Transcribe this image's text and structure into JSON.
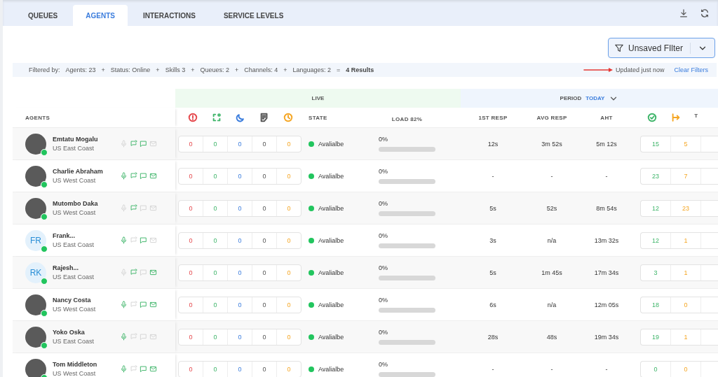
{
  "tabs": [
    {
      "label": "QUEUES",
      "selected": false
    },
    {
      "label": "AGENTS",
      "selected": true
    },
    {
      "label": "INTERACTIONS",
      "selected": false
    },
    {
      "label": "SERVICE LEVELS",
      "selected": false
    }
  ],
  "filter_button": {
    "label": "Unsaved FIlter"
  },
  "filter_bar": {
    "prefix": "Filtered by:",
    "items": [
      {
        "kind": "filter",
        "text": "Agents: 23"
      },
      {
        "kind": "operator",
        "text": "+"
      },
      {
        "kind": "filter",
        "text": "Status: Online"
      },
      {
        "kind": "operator",
        "text": "+"
      },
      {
        "kind": "filter",
        "text": "Skills 3"
      },
      {
        "kind": "operator",
        "text": "+"
      },
      {
        "kind": "filter",
        "text": "Queues: 2"
      },
      {
        "kind": "operator",
        "text": "+"
      },
      {
        "kind": "filter",
        "text": "Channels: 4"
      },
      {
        "kind": "operator",
        "text": "+"
      },
      {
        "kind": "filter",
        "text": "Languages: 2"
      },
      {
        "kind": "operator",
        "text": "="
      },
      {
        "kind": "result",
        "text": "4 Results"
      }
    ],
    "updated": "Updated just now",
    "clear": "Clear Filters"
  },
  "table": {
    "agents_header": "AGENTS",
    "live_label": "LIVE",
    "period_label": "PERIOD",
    "period_value": "TODAY",
    "live_columns": [
      {
        "color": "#e5484d"
      },
      {
        "color": "#3fb56a"
      },
      {
        "color": "#3b7ddd"
      },
      {
        "color": "#555555"
      },
      {
        "color": "#f5a623"
      }
    ],
    "state_header": "STATE",
    "load_header": "LOAD 82%",
    "period_headers": [
      "1ST RESP",
      "AVG RESP",
      "AHT"
    ],
    "period_columns": [
      {
        "color": "#3fb56a"
      },
      {
        "color": "#f5a623"
      }
    ],
    "cut_header": "T",
    "rows": [
      {
        "name": "Emtatu Mogalu",
        "region": "US East Coast",
        "avatar": {
          "kind": "photo"
        },
        "online": true,
        "channels": [
          {
            "on": false
          },
          {
            "on": true
          },
          {
            "on": true
          },
          {
            "on": false
          }
        ],
        "live": [
          "0",
          "0",
          "0",
          "0",
          "0"
        ],
        "state": {
          "label": "Avalialbe",
          "color": "#22c55e"
        },
        "load": {
          "reading": "0%",
          "level": 0
        },
        "resp": [
          "12s",
          "3m 52s",
          "5m 12s"
        ],
        "totals": [
          "15",
          "5"
        ]
      },
      {
        "name": "Charlie Abraham",
        "region": "US West Coast",
        "avatar": {
          "kind": "photo"
        },
        "online": true,
        "channels": [
          {
            "on": true
          },
          {
            "on": true
          },
          {
            "on": true
          },
          {
            "on": true
          }
        ],
        "live": [
          "0",
          "0",
          "0",
          "0",
          "0"
        ],
        "state": {
          "label": "Avalialbe",
          "color": "#22c55e"
        },
        "load": {
          "reading": "0%",
          "level": 0
        },
        "resp": [
          "-",
          "-",
          "-"
        ],
        "totals": [
          "23",
          "7"
        ]
      },
      {
        "name": "Mutombo Daka",
        "region": "US West Coast",
        "avatar": {
          "kind": "photo"
        },
        "online": true,
        "channels": [
          {
            "on": false
          },
          {
            "on": true
          },
          {
            "on": false
          },
          {
            "on": false
          }
        ],
        "live": [
          "0",
          "0",
          "0",
          "0",
          "0"
        ],
        "state": {
          "label": "Avalialbe",
          "color": "#22c55e"
        },
        "load": {
          "reading": "0%",
          "level": 0
        },
        "resp": [
          "5s",
          "52s",
          "8m 54s"
        ],
        "totals": [
          "12",
          "23"
        ]
      },
      {
        "name": "Frank...",
        "region": "US East Coast",
        "avatar": {
          "kind": "initials",
          "initials": "FR"
        },
        "online": true,
        "channels": [
          {
            "on": true
          },
          {
            "on": false
          },
          {
            "on": true
          },
          {
            "on": false
          }
        ],
        "live": [
          "0",
          "0",
          "0",
          "0",
          "0"
        ],
        "state": {
          "label": "Avalialbe",
          "color": "#22c55e"
        },
        "load": {
          "reading": "0%",
          "level": 0
        },
        "resp": [
          "3s",
          "n/a",
          "13m 32s"
        ],
        "totals": [
          "12",
          "1"
        ]
      },
      {
        "name": "Rajesh...",
        "region": "US East Coast",
        "avatar": {
          "kind": "initials",
          "initials": "RK"
        },
        "online": true,
        "channels": [
          {
            "on": false
          },
          {
            "on": true
          },
          {
            "on": false
          },
          {
            "on": true
          }
        ],
        "live": [
          "0",
          "0",
          "0",
          "0",
          "0"
        ],
        "state": {
          "label": "Avalialbe",
          "color": "#22c55e"
        },
        "load": {
          "reading": "0%",
          "level": 0
        },
        "resp": [
          "5s",
          "1m 45s",
          "17m 34s"
        ],
        "totals": [
          "3",
          "1"
        ]
      },
      {
        "name": "Nancy Costa",
        "region": "US West Coast",
        "avatar": {
          "kind": "photo"
        },
        "online": true,
        "channels": [
          {
            "on": true
          },
          {
            "on": false
          },
          {
            "on": true
          },
          {
            "on": true
          }
        ],
        "live": [
          "0",
          "0",
          "0",
          "0",
          "0"
        ],
        "state": {
          "label": "Avalialbe",
          "color": "#22c55e"
        },
        "load": {
          "reading": "0%",
          "level": 0
        },
        "resp": [
          "6s",
          "n/a",
          "12m 05s"
        ],
        "totals": [
          "18",
          "0"
        ]
      },
      {
        "name": "Yoko Oska",
        "region": "US East Coast",
        "avatar": {
          "kind": "photo"
        },
        "online": true,
        "channels": [
          {
            "on": true
          },
          {
            "on": false
          },
          {
            "on": false
          },
          {
            "on": false
          }
        ],
        "live": [
          "0",
          "0",
          "0",
          "0",
          "0"
        ],
        "state": {
          "label": "Avalialbe",
          "color": "#22c55e"
        },
        "load": {
          "reading": "0%",
          "level": 0
        },
        "resp": [
          "28s",
          "48s",
          "19m 34s"
        ],
        "totals": [
          "19",
          "1"
        ]
      },
      {
        "name": "Tom Middleton",
        "region": "US West Coast",
        "avatar": {
          "kind": "photo"
        },
        "online": true,
        "channels": [
          {
            "on": true
          },
          {
            "on": false
          },
          {
            "on": true
          },
          {
            "on": true
          }
        ],
        "live": [
          "0",
          "0",
          "0",
          "0",
          "0"
        ],
        "state": {
          "label": "Avalialbe",
          "color": "#22c55e"
        },
        "load": {
          "reading": "0%",
          "level": 0
        },
        "resp": [
          "-",
          "-",
          "-"
        ],
        "totals": [
          "0",
          "0"
        ]
      }
    ]
  }
}
